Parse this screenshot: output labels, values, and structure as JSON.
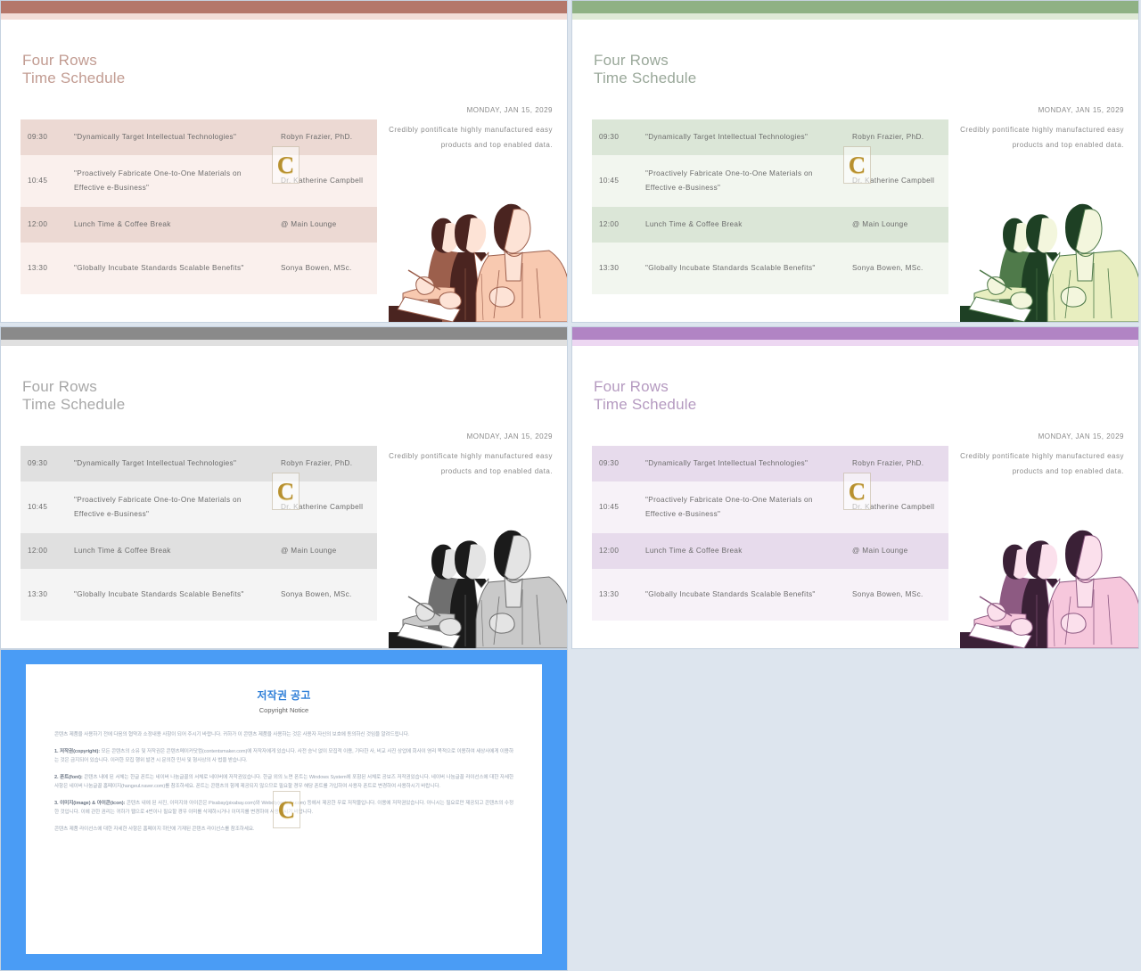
{
  "page": {
    "background": "#dde5ee"
  },
  "watermark": {
    "letter": "C",
    "color": "#b7902f"
  },
  "slide_common": {
    "title": "Four Rows\nTime Schedule",
    "date": "MONDAY, JAN 15, 2029",
    "blurb": "Credibly pontificate highly manufactured easy products and top enabled data.",
    "rows": [
      {
        "time": "09:30",
        "topic": "\"Dynamically Target Intellectual Technologies\"",
        "who": "Robyn Frazier, PhD."
      },
      {
        "time": "10:45",
        "topic": "\"Proactively Fabricate One-to-One Materials on Effective e-Business\"",
        "who": "Dr. Katherine Campbell"
      },
      {
        "time": "12:00",
        "topic": "Lunch Time & Coffee Break",
        "who": "@ Main Lounge"
      },
      {
        "time": "13:30",
        "topic": "\"Globally Incubate Standards Scalable Benefits\"",
        "who": "Sonya Bowen, MSc."
      }
    ]
  },
  "slides": [
    {
      "variant": "rose",
      "bar": "#b4776a",
      "bar_sub": "#f2ddd7",
      "title_color": "#c29c92",
      "row_shade": "#ecd9d3",
      "row_light": "#faf0ed",
      "ink_dark": "#4a2420",
      "ink_mid": "#9c5f4c",
      "ink_skin": "#f8c9b0",
      "ink_light": "#fde3d6"
    },
    {
      "variant": "green",
      "bar": "#8fb184",
      "bar_sub": "#dfe9d6",
      "title_color": "#9aa89a",
      "row_shade": "#dbe6d7",
      "row_light": "#f2f6ef",
      "ink_dark": "#1e4024",
      "ink_mid": "#4f7a4a",
      "ink_skin": "#e8eec0",
      "ink_light": "#f3f6dd"
    },
    {
      "variant": "gray",
      "bar": "#8a8a8a",
      "bar_sub": "#e0e0e0",
      "title_color": "#a8a8a8",
      "row_shade": "#e0e0e0",
      "row_light": "#f4f4f4",
      "ink_dark": "#1b1b1b",
      "ink_mid": "#6f6f6f",
      "ink_skin": "#c9c9c9",
      "ink_light": "#e4e4e4"
    },
    {
      "variant": "purple",
      "bar": "#b184c4",
      "bar_sub": "#edd7f2",
      "title_color": "#b59ac0",
      "row_shade": "#e7dbec",
      "row_light": "#f7f2f8",
      "ink_dark": "#3a2036",
      "ink_mid": "#8d5a82",
      "ink_skin": "#f6c7dc",
      "ink_light": "#fbe0ec"
    }
  ],
  "copyright": {
    "title": "저작권 공고",
    "subtitle": "Copyright Notice",
    "accent": "#4a9cf5",
    "paragraphs": [
      {
        "lead": "",
        "text": "콘텐츠 제품을 사용하기 전에 다음의 협약과 소정내용 사항이 되어 주시기 바랍니다. 귀하가 이 콘텐츠 제품을 사용하는 것은 사용자 자신의 보호에 동의하신 것임을 알려드립니다."
      },
      {
        "lead": "1. 저작권(copyright):",
        "text": " 모든 콘텐츠의 소유 및 저작권은 콘텐츠메이커닷컴(contentsmaker.com)에 저작자에게 있습니다. 사전 승낙 없이 모집적 이용, 기타한 사, 비교 사진 상업에 회사이 영리 목적으로 이용하여 세상사에게 이용하는 것은 금지되어 있습니다. 이러한 모집 행위 발견 시 문의한 민사 및 형사상의 사 법을 받습니다."
      },
      {
        "lead": "2. 폰트(font):",
        "text": " 콘텐츠 내에 된 서체는 한글 폰트는 네이버 나눔글꼴의 서체로 네이버에 저작권있습니다. 한글 외의 노면 폰트는 Windows System에 포함된 서체로 공보즈 저작권있습니다. 네이버 나눔글꼴 라이선스에 대한 자세한 사항은 네이버 나눔글꼴 홈페이지(hangeul.naver.com)를 참조하세요. 폰트는 콘텐츠의 함께 제공되지 않으므로 필요할 경우 해당 폰트를 가입하여 사용자 폰트로 변경하여 사용하시기 바랍니다."
      },
      {
        "lead": "3. 이미지(image) & 아이콘(icon):",
        "text": " 콘텐츠 내에 된 사진, 이미지와 아이콘은 Pixabay(pixabay.com)와 Webdly(webdly.com) 등에서 제공한 무료 저작물입니다. 이용에 저작권있습니다. 아니시는 필요로만 제공되고 콘텐츠의 수정한 것입니다. 이에 관한 권리는 귀하가 웹으로 4번이나 필요할 경우 이미를 삭제하시거나 이미지를 변경하여 사용하시기 바랍니다."
      },
      {
        "lead": "",
        "text": "콘텐츠 제품 라이선스에 대한 자세한 사항은 홈페이지 하단에 기재된 콘텐츠 라이선스를 참조하세요."
      }
    ]
  }
}
